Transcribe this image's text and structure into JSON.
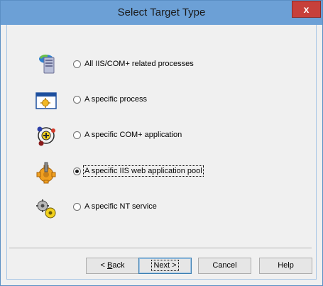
{
  "window": {
    "title": "Select Target Type",
    "close_glyph": "x"
  },
  "options": [
    {
      "label": "All IIS/COM+ related processes",
      "icon": "server-icon",
      "selected": false
    },
    {
      "label": "A specific process",
      "icon": "process-window-icon",
      "selected": false
    },
    {
      "label": "A specific COM+ application",
      "icon": "com-plus-icon",
      "selected": false
    },
    {
      "label": "A specific IIS web application pool",
      "icon": "gear-icon",
      "selected": true
    },
    {
      "label": "A specific NT service",
      "icon": "gears-service-icon",
      "selected": false
    }
  ],
  "buttons": {
    "back_prefix": "< ",
    "back_mnemonic": "B",
    "back_rest": "ack",
    "next_label": "Next >",
    "cancel_label": "Cancel",
    "help_label": "Help"
  },
  "colors": {
    "titlebar": "#6ca0d6",
    "close": "#c7403b",
    "accent": "#3c7fb1"
  }
}
